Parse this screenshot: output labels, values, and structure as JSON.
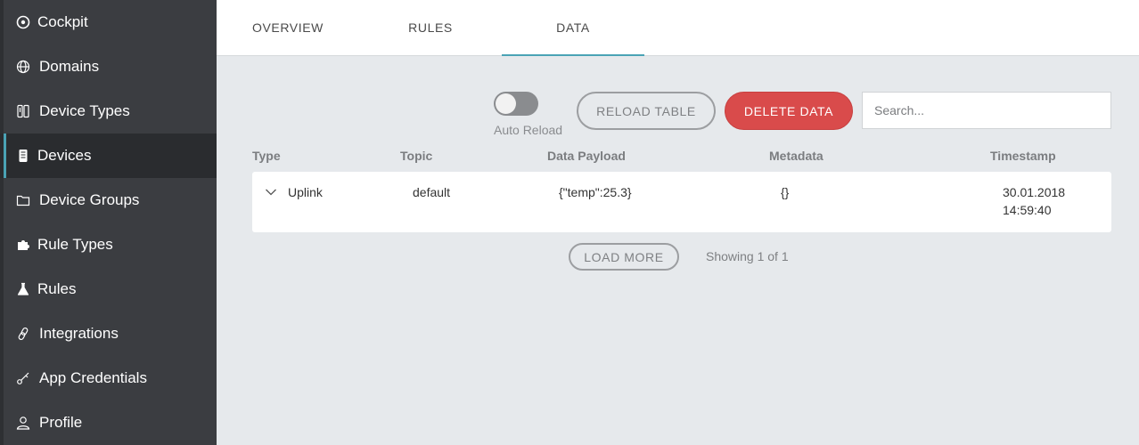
{
  "sidebar": {
    "items": [
      {
        "label": "Cockpit",
        "icon": "compass-icon"
      },
      {
        "label": "Domains",
        "icon": "globe-icon"
      },
      {
        "label": "Device Types",
        "icon": "device-types-icon"
      },
      {
        "label": "Devices",
        "icon": "device-icon",
        "active": true
      },
      {
        "label": "Device Groups",
        "icon": "folder-icon"
      },
      {
        "label": "Rule Types",
        "icon": "puzzle-icon"
      },
      {
        "label": "Rules",
        "icon": "flask-icon"
      },
      {
        "label": "Integrations",
        "icon": "link-icon"
      },
      {
        "label": "App Credentials",
        "icon": "key-icon"
      },
      {
        "label": "Profile",
        "icon": "user-icon"
      }
    ]
  },
  "tabs": [
    {
      "label": "OVERVIEW"
    },
    {
      "label": "RULES"
    },
    {
      "label": "DATA",
      "active": true
    }
  ],
  "toolbar": {
    "auto_reload_label": "Auto Reload",
    "auto_reload_on": false,
    "reload_label": "RELOAD TABLE",
    "delete_label": "DELETE DATA",
    "search_placeholder": "Search...",
    "search_value": ""
  },
  "table": {
    "columns": [
      "Type",
      "Topic",
      "Data Payload",
      "Metadata",
      "Timestamp"
    ],
    "rows": [
      {
        "type": "Uplink",
        "topic": "default",
        "payload": "{\"temp\":25.3}",
        "metadata": "{}",
        "timestamp_date": "30.01.2018",
        "timestamp_time": "14:59:40"
      }
    ]
  },
  "footer": {
    "load_more_label": "LOAD MORE",
    "showing_text": "Showing 1 of 1"
  },
  "colors": {
    "accent": "#4aa3b5",
    "danger": "#d94b4b",
    "sidebar_bg": "#3b3d41",
    "content_bg": "#e6e9ec"
  }
}
